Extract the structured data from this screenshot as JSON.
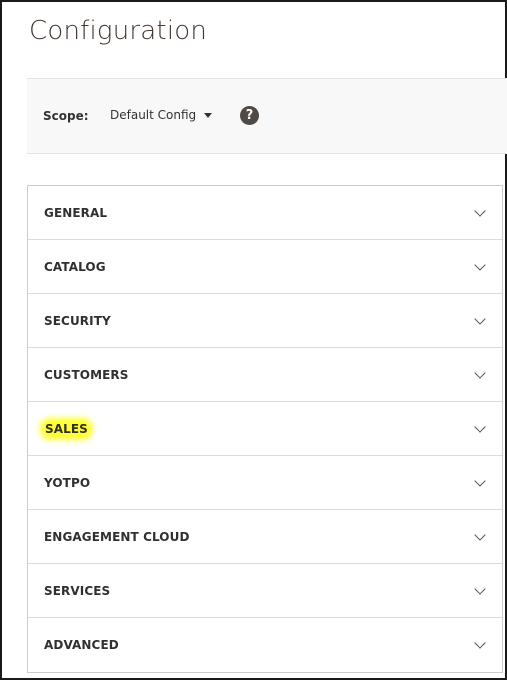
{
  "page": {
    "title": "Configuration"
  },
  "scope": {
    "label": "Scope:",
    "value": "Default Config",
    "help_glyph": "?"
  },
  "sections": [
    {
      "label": "GENERAL",
      "highlighted": false
    },
    {
      "label": "CATALOG",
      "highlighted": false
    },
    {
      "label": "SECURITY",
      "highlighted": false
    },
    {
      "label": "CUSTOMERS",
      "highlighted": false
    },
    {
      "label": "SALES",
      "highlighted": true
    },
    {
      "label": "YOTPO",
      "highlighted": false
    },
    {
      "label": "ENGAGEMENT CLOUD",
      "highlighted": false
    },
    {
      "label": "SERVICES",
      "highlighted": false
    },
    {
      "label": "ADVANCED",
      "highlighted": false
    }
  ],
  "icons": {
    "expand": "chevron-down-icon",
    "help": "help-icon",
    "scope_dropdown": "caret-down-icon"
  },
  "colors": {
    "highlight": "#ffff33",
    "help_icon_bg": "#514943",
    "title_text": "#41362f"
  }
}
